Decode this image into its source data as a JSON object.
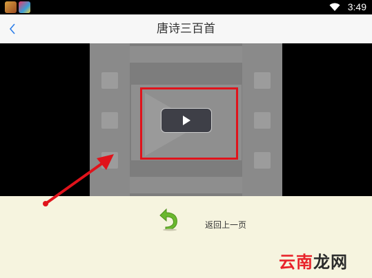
{
  "status_bar": {
    "time": "3:49"
  },
  "header": {
    "title": "唐诗三百首",
    "back_icon": "chevron-left-icon"
  },
  "video": {
    "play_icon": "play-icon"
  },
  "bottom": {
    "return_label": "返回上一页",
    "return_icon": "return-arrow-icon"
  },
  "watermark": {
    "part1": "云南",
    "part2": "龙网"
  },
  "colors": {
    "accent": "#2b7de9",
    "annotation_red": "#e0131b",
    "panel_bg": "#f6f4df",
    "return_green": "#6ab82e"
  }
}
